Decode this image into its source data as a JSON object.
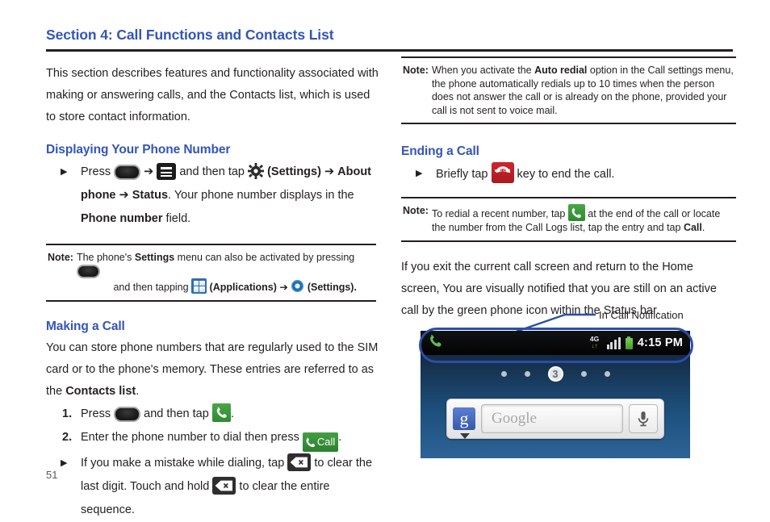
{
  "document": {
    "section_title": "Section 4: Call Functions and Contacts List",
    "page_number": "51",
    "accent_color": "#3355b8",
    "rule_color": "#231f20"
  },
  "left_column": {
    "intro_paragraph": "This section describes features and functionality associated with making or answering calls, and the Contacts list, which is used to store contact information.",
    "displaying_number": {
      "heading": "Displaying Your Phone Number",
      "step": {
        "marker": "▶",
        "t1": "Press",
        "icon1": "home-key-icon",
        "arrow1": "➔",
        "icon2": "menu-key-icon",
        "t2": "and then tap",
        "icon3": "gear-icon",
        "t3": "(Settings)",
        "arrow2": "➔",
        "b1": "About phone",
        "arrow3": "➔",
        "b2": "Status",
        "t4": ". Your phone number displays in the",
        "b3": "Phone number",
        "t5": "field."
      }
    },
    "note_settings": {
      "label": "Note:",
      "line1_a": "The phone's",
      "line1_b": "Settings",
      "line1_c": "menu can also be activated by pressing",
      "line1_icon": "home-key-icon",
      "line2_a": "and then tapping",
      "line2_icon1": "applications-grid-icon",
      "line2_b": "(Applications)",
      "line2_arrow": "➔",
      "line2_icon2": "settings-gear-blue-icon",
      "line2_c": "(Settings)."
    },
    "making_a_call": {
      "heading": "Making a Call",
      "paragraph_a": "You can store phone numbers that are regularly used to the SIM card or to the phone's memory. These entries are referred to as the",
      "paragraph_b": "Contacts list",
      "paragraph_c": ".",
      "step1": {
        "marker": "1.",
        "t1": "Press",
        "icon1": "home-key-icon",
        "t2": "and then tap",
        "icon2": "phone-dialer-green-icon",
        "t3": "."
      },
      "step2": {
        "marker": "2.",
        "t1": "Enter the phone number to dial then press",
        "icon1": "call-button-green-icon",
        "icon1_label": "Call",
        "t2": "."
      },
      "step3": {
        "marker": "▶",
        "t1": "If you make a mistake while dialing, tap",
        "icon1": "backspace-clear-icon",
        "t2": "to clear the last digit. Touch and hold",
        "icon2": "backspace-clear-icon",
        "t3": "to clear the entire sequence."
      }
    }
  },
  "right_column": {
    "note_auto_redial": {
      "label": "Note:",
      "text_a": "When you activate the",
      "text_b": "Auto redial",
      "text_c": "option in the Call settings menu, the phone automatically redials up to 10 times when the person does not answer the call or is already on the phone, provided your call is not sent to voice mail."
    },
    "ending_a_call": {
      "heading": "Ending a Call",
      "step": {
        "marker": "▶",
        "t1": "Briefly tap",
        "icon1": "end-call-button-icon",
        "icon1_label": "End Call",
        "t2": "key to end the call."
      }
    },
    "note_redial": {
      "label": "Note:",
      "text_a": "To redial a recent number, tap",
      "icon": "phone-dialer-green-icon",
      "text_b": "at the end of the call or locate the number from the Call Logs list, tap the entry and tap",
      "text_c": "Call",
      "text_d": "."
    },
    "exit_paragraph": "If you exit the current call screen and return to the Home screen, You are visually notified that you are still on an active call by the green phone icon within the Status bar.",
    "callout": {
      "label": "In Call Notification",
      "color": "#2b4ea8"
    }
  },
  "phone_screenshot": {
    "status_bar": {
      "in_call_icon": "in-call-phone-icon",
      "network_label": "4G",
      "network_down_arrow": "↓",
      "network_up_arrow": "↑",
      "signal_icon": "signal-bars-icon",
      "battery_icon": "battery-full-icon",
      "clock": "4:15 PM"
    },
    "home_screen": {
      "page_dots": [
        "•",
        "•",
        "3",
        "•",
        "•"
      ],
      "current_page": "3",
      "search_widget": {
        "logo": "g",
        "placeholder": "Google",
        "mic_icon": "microphone-icon",
        "dropdown_icon": "caret-down-icon"
      }
    }
  }
}
